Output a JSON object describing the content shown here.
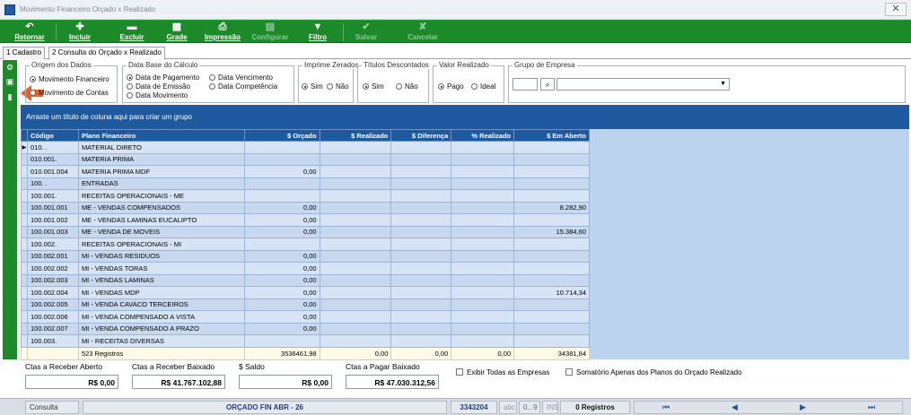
{
  "window": {
    "title": "Movimento Financeiro Orçado x Realizado",
    "close": "✕"
  },
  "toolbar": {
    "items": [
      {
        "label": "Retornar",
        "icon": "↶"
      },
      {
        "label": "Incluir",
        "icon": "✚"
      },
      {
        "label": "Excluir",
        "icon": "▬"
      },
      {
        "label": "Grade",
        "icon": "▦"
      },
      {
        "label": "Impressão",
        "icon": "⎙"
      },
      {
        "label": "Configurar",
        "icon": "▤"
      },
      {
        "label": "Filtro",
        "icon": "▼"
      },
      {
        "label": "Salvar",
        "icon": "✔"
      },
      {
        "label": "Cancelar",
        "icon": "✘"
      }
    ]
  },
  "tabs": [
    {
      "label": "1 Cadastro"
    },
    {
      "label": "2 Consulta do Orçado x Realizado"
    }
  ],
  "filters": {
    "origem": {
      "title": "Origem dos Dados",
      "opt1": "Movimento Financeiro",
      "opt2": "Movimento de Contas"
    },
    "database": {
      "title": "Data Base do Cálculo",
      "opt1": "Data de Pagamento",
      "opt2": "Data de Emissão",
      "opt3": "Data Movimento",
      "opt4": "Data Vencimento",
      "opt5": "Data Competência"
    },
    "zerados": {
      "title": "Imprime Zerados",
      "yes": "Sim",
      "no": "Não"
    },
    "descontados": {
      "title": "Títulos Descontados",
      "yes": "Sim",
      "no": "Não"
    },
    "valor": {
      "title": "Valor Realizado",
      "opt1": "Pago",
      "opt2": "Ideal"
    },
    "empresa": {
      "title": "Grupo de Empresa"
    }
  },
  "grid": {
    "group_hint": "Arraste um título de coluna aqui para criar um grupo",
    "columns": [
      "Código",
      "Plano Financeiro",
      "$ Orçado",
      "$ Realizado",
      "$ Diferença",
      "% Realizado",
      "$ Em Aberto"
    ],
    "rows": [
      [
        "010.  .",
        "MATERIAL DIRETO",
        "",
        "",
        "",
        "",
        ""
      ],
      [
        "010.001.",
        "MATERIA PRIMA",
        "",
        "",
        "",
        "",
        ""
      ],
      [
        "010.001.004",
        "MATERIA PRIMA MDF",
        "0,00",
        "",
        "",
        "",
        ""
      ],
      [
        "100.  .",
        "ENTRADAS",
        "",
        "",
        "",
        "",
        ""
      ],
      [
        "100.001.",
        "RECEITAS OPERACIONAIS - ME",
        "",
        "",
        "",
        "",
        ""
      ],
      [
        "100.001.001",
        "ME - VENDAS COMPENSADOS",
        "0,00",
        "",
        "",
        "",
        "8.282,90"
      ],
      [
        "100.001.002",
        "ME - VENDAS LAMINAS EUCALIPTO",
        "0,00",
        "",
        "",
        "",
        ""
      ],
      [
        "100.001.003",
        "ME - VENDA DE MOVEIS",
        "0,00",
        "",
        "",
        "",
        "15.384,60"
      ],
      [
        "100.002.",
        "RECEITAS OPERACIONAIS - MI",
        "",
        "",
        "",
        "",
        ""
      ],
      [
        "100.002.001",
        "MI - VENDAS RESIDUOS",
        "0,00",
        "",
        "",
        "",
        ""
      ],
      [
        "100.002.002",
        "MI - VENDAS TORAS",
        "0,00",
        "",
        "",
        "",
        ""
      ],
      [
        "100.002.003",
        "MI - VENDAS LAMINAS",
        "0,00",
        "",
        "",
        "",
        ""
      ],
      [
        "100.002.004",
        "MI - VENDAS MDP",
        "0,00",
        "",
        "",
        "",
        "10.714,34"
      ],
      [
        "100.002.005",
        "MI - VENDA CAVACO TERCEIROS",
        "0,00",
        "",
        "",
        "",
        ""
      ],
      [
        "100.002.006",
        "MI - VENDA COMPENSADO A VISTA",
        "0,00",
        "",
        "",
        "",
        ""
      ],
      [
        "100.002.007",
        "MI - VENDA COMPENSADO A PRAZO",
        "0,00",
        "",
        "",
        "",
        ""
      ],
      [
        "100.003.",
        "MI - RECEITAS DIVERSAS",
        "",
        "",
        "",
        "",
        ""
      ]
    ],
    "footer": [
      "",
      "523 Registros",
      "3536461,98",
      "0,00",
      "0,00",
      "0,00",
      "34381,84"
    ]
  },
  "summary": [
    {
      "label": "Ctas a Receber Aberto",
      "value": "R$ 0,00"
    },
    {
      "label": "Ctas a Receber Baixado",
      "value": "R$ 41.767.102,88"
    },
    {
      "label": "$ Saldo",
      "value": "R$ 0,00"
    },
    {
      "label": "Ctas a Pagar Baixado",
      "value": "R$ 47.030.312,56"
    }
  ],
  "checks": {
    "todas": "Exibir Todas as Empresas",
    "somatorio": "Somatório Apenas dos Planos do Orçado Realizado"
  },
  "status": {
    "mode": "Consulta",
    "name": "ORÇADO FIN ABR - 26",
    "id": "3343204",
    "abc": "abc",
    "range": "0...9",
    "ins": "INS",
    "records": "0 Registros"
  }
}
